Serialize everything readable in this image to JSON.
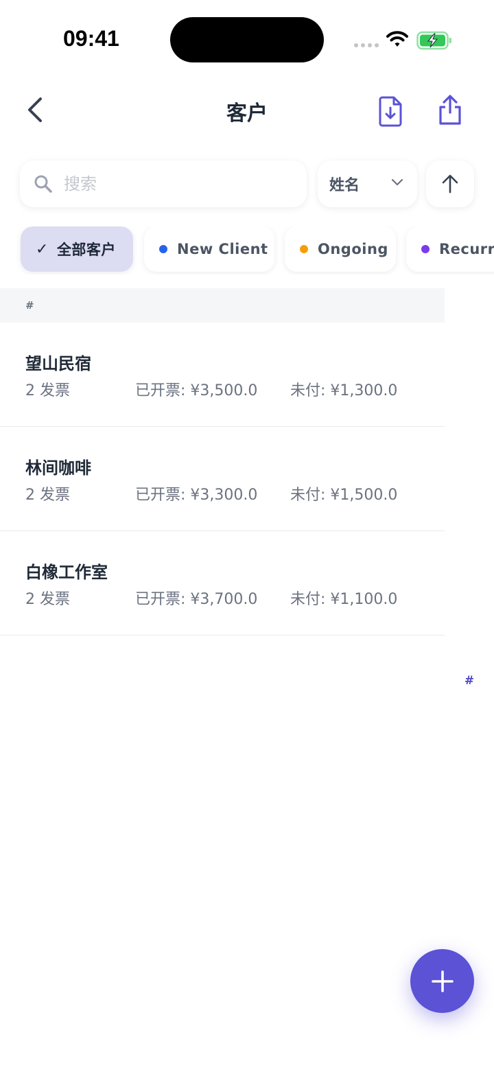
{
  "status_bar": {
    "time": "09:41"
  },
  "nav": {
    "title": "客户"
  },
  "search": {
    "placeholder": "搜索",
    "value": ""
  },
  "sort": {
    "selected": "姓名"
  },
  "filters": [
    {
      "label": "全部客户",
      "active": true,
      "dot_color": ""
    },
    {
      "label": "New Client",
      "active": false,
      "dot_color": "#2563eb"
    },
    {
      "label": "Ongoing",
      "active": false,
      "dot_color": "#f59e0b"
    },
    {
      "label": "Recurring",
      "active": false,
      "dot_color": "#7c3aed"
    }
  ],
  "list": {
    "section": "#",
    "rows": [
      {
        "name": "望山民宿",
        "count": "2 发票",
        "invoiced": "已开票: ¥3,500.0",
        "unpaid": "未付: ¥1,300.0"
      },
      {
        "name": "林间咖啡",
        "count": "2 发票",
        "invoiced": "已开票: ¥3,300.0",
        "unpaid": "未付: ¥1,500.0"
      },
      {
        "name": "白橡工作室",
        "count": "2 发票",
        "invoiced": "已开票: ¥3,700.0",
        "unpaid": "未付: ¥1,100.0"
      }
    ]
  },
  "index_bar": [
    "#"
  ],
  "colors": {
    "accent": "#5b52d6",
    "chip_active_bg": "#dcdcf3",
    "battery_green": "#34c759",
    "text_primary": "#1f2937",
    "text_secondary": "#6b7280"
  },
  "icons": {
    "back": "chevron-left-icon",
    "import": "file-download-icon",
    "share": "share-icon",
    "search": "magnifier-icon",
    "sort_dropdown": "chevron-down-icon",
    "sort_order": "arrow-up-icon",
    "add": "plus-icon"
  }
}
